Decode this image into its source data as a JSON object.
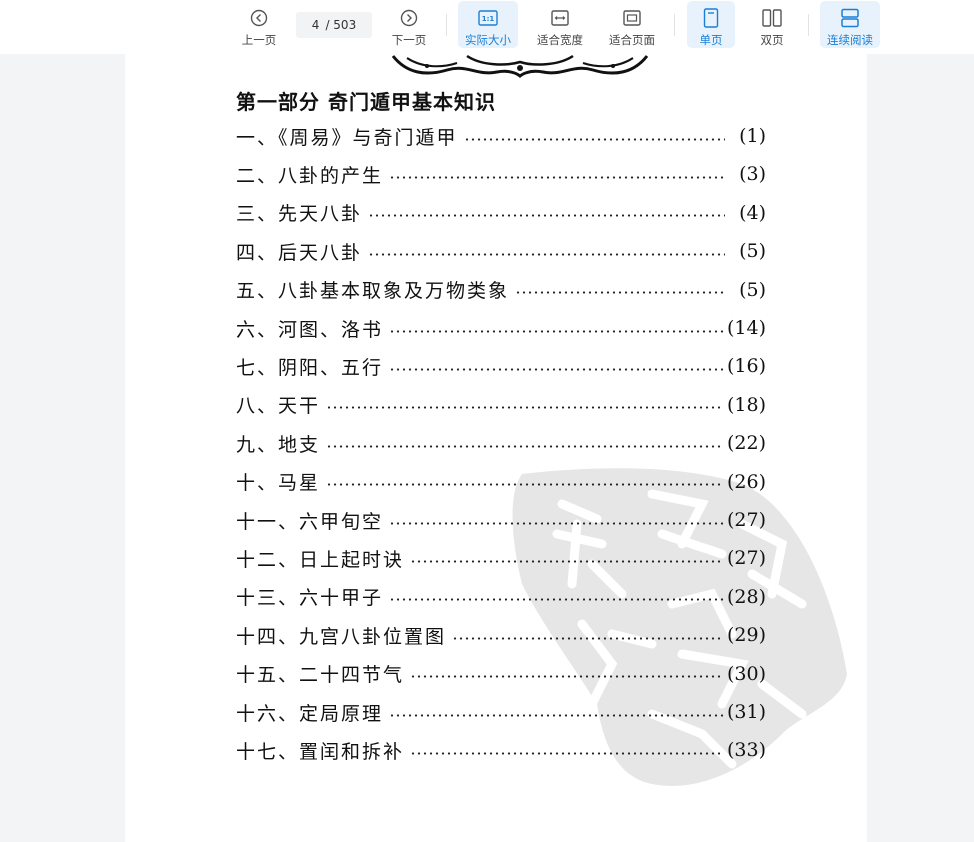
{
  "toolbar": {
    "prev_label": "上一页",
    "next_label": "下一页",
    "current_page": "4",
    "total_pages": "/ 503",
    "actual_size_label": "实际大小",
    "actual_size_icon_text": "1:1",
    "fit_width_label": "适合宽度",
    "fit_page_label": "适合页面",
    "single_page_label": "单页",
    "double_page_label": "双页",
    "continuous_label": "连续阅读",
    "accent_color": "#1a7fd4",
    "active_bg": "#e8f2fc"
  },
  "document": {
    "part_title": "第一部分  奇门遁甲基本知识",
    "toc": [
      {
        "title": "一、《周易》与奇门遁甲",
        "page": "(1)"
      },
      {
        "title": "二、八卦的产生",
        "page": "(3)"
      },
      {
        "title": "三、先天八卦",
        "page": "(4)"
      },
      {
        "title": "四、后天八卦",
        "page": "(5)"
      },
      {
        "title": "五、八卦基本取象及万物类象",
        "page": "(5)"
      },
      {
        "title": "六、河图、洛书",
        "page": "(14)"
      },
      {
        "title": "七、阴阳、五行",
        "page": "(16)"
      },
      {
        "title": "八、天干",
        "page": "(18)"
      },
      {
        "title": "九、地支",
        "page": "(22)"
      },
      {
        "title": "十、马星",
        "page": "(26)"
      },
      {
        "title": "十一、六甲旬空",
        "page": "(27)"
      },
      {
        "title": "十二、日上起时诀",
        "page": "(27)"
      },
      {
        "title": "十三、六十甲子",
        "page": "(28)"
      },
      {
        "title": "十四、九宫八卦位置图",
        "page": "(29)"
      },
      {
        "title": "十五、二十四节气",
        "page": "(30)"
      },
      {
        "title": "十六、定局原理",
        "page": "(31)"
      },
      {
        "title": "十七、置闰和拆补",
        "page": "(33)"
      }
    ]
  }
}
